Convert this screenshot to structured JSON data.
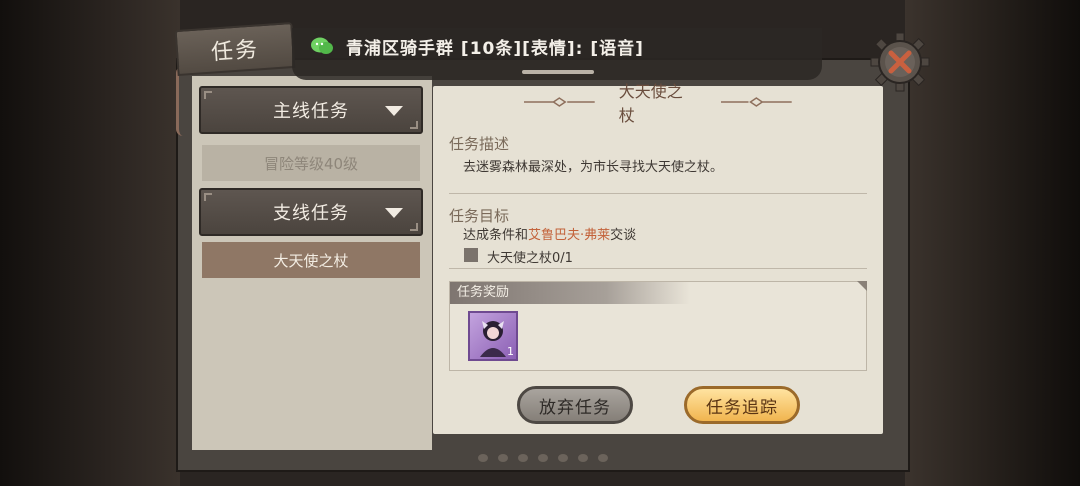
{
  "tab": {
    "label": "任务"
  },
  "chat": {
    "message": "青浦区骑手群 [10条][表情]: [语音]"
  },
  "left_panel": {
    "categories": [
      {
        "label": "主线任务"
      },
      {
        "label": "支线任务"
      }
    ],
    "locked_item": "冒险等级40级",
    "active_item": "大天使之杖"
  },
  "quest": {
    "title": "大天使之杖",
    "description_label": "任务描述",
    "description": "去迷雾森林最深处，为市长寻找大天使之杖。",
    "goal_label": "任务目标",
    "goal_prefix": "达成条件和",
    "goal_npc": "艾鲁巴夫·弗莱",
    "goal_suffix": "交谈",
    "objective": "大天使之杖0/1",
    "rewards_label": "任务奖励",
    "reward_count": "1"
  },
  "buttons": {
    "abandon": "放弃任务",
    "track": "任务追踪"
  },
  "icons": {
    "chat": "wechat-icon",
    "close": "close-gear-icon",
    "dropdown": "triangle-down-icon",
    "reward": "character-card-icon"
  },
  "colors": {
    "npc_highlight": "#c3623a",
    "track_button": "#f1b54f",
    "active_item": "#8f7765"
  }
}
